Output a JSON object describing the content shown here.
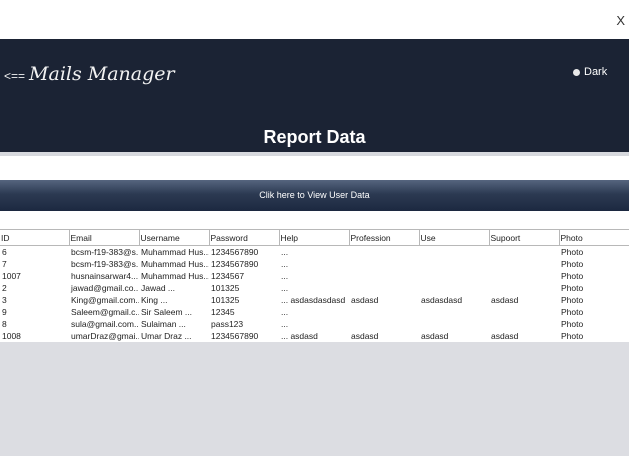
{
  "window": {
    "close_label": "X"
  },
  "header": {
    "back_arrow": "<==",
    "app_title": "Mails Manager",
    "dark_label": "Dark",
    "report_title": "Report Data"
  },
  "view_button": "Clik here to View User Data",
  "table": {
    "columns": [
      "ID",
      "Email",
      "Username",
      "Password",
      "Help",
      "Profession",
      "Use",
      "Supoort",
      "Photo"
    ],
    "rows": [
      [
        "6",
        "bcsm-f19-383@s...",
        "Muhammad Hus...",
        "1234567890",
        "...",
        "",
        "",
        "",
        "Photo"
      ],
      [
        "7",
        "bcsm-f19-383@s...",
        "Muhammad Hus...",
        "1234567890",
        "...",
        "",
        "",
        "",
        "Photo"
      ],
      [
        "1007",
        "husnainsarwar4...",
        "Muhammad Hus...",
        "1234567",
        "...",
        "",
        "",
        "",
        "Photo"
      ],
      [
        "2",
        "jawad@gmail.co...",
        "Jawad          ...",
        "101325",
        "...",
        "",
        "",
        "",
        "Photo"
      ],
      [
        "3",
        "King@gmail.com...",
        "King            ...",
        "101325",
        "...  asdasdasdasd",
        "asdasd",
        "asdasdasd",
        "asdasd",
        "Photo"
      ],
      [
        "9",
        "Saleem@gmail.c...",
        "Sir Saleem     ...",
        "12345",
        "...",
        "",
        "",
        "",
        "Photo"
      ],
      [
        "8",
        "sula@gmail.com...",
        "Sulaiman        ...",
        "pass123",
        "...",
        "",
        "",
        "",
        "Photo"
      ],
      [
        "1008",
        "umarDraz@gmai...",
        "Umar Draz      ...",
        "1234567890",
        "...  asdasd",
        "asdasd",
        "asdasd",
        "asdasd",
        "Photo"
      ]
    ]
  }
}
